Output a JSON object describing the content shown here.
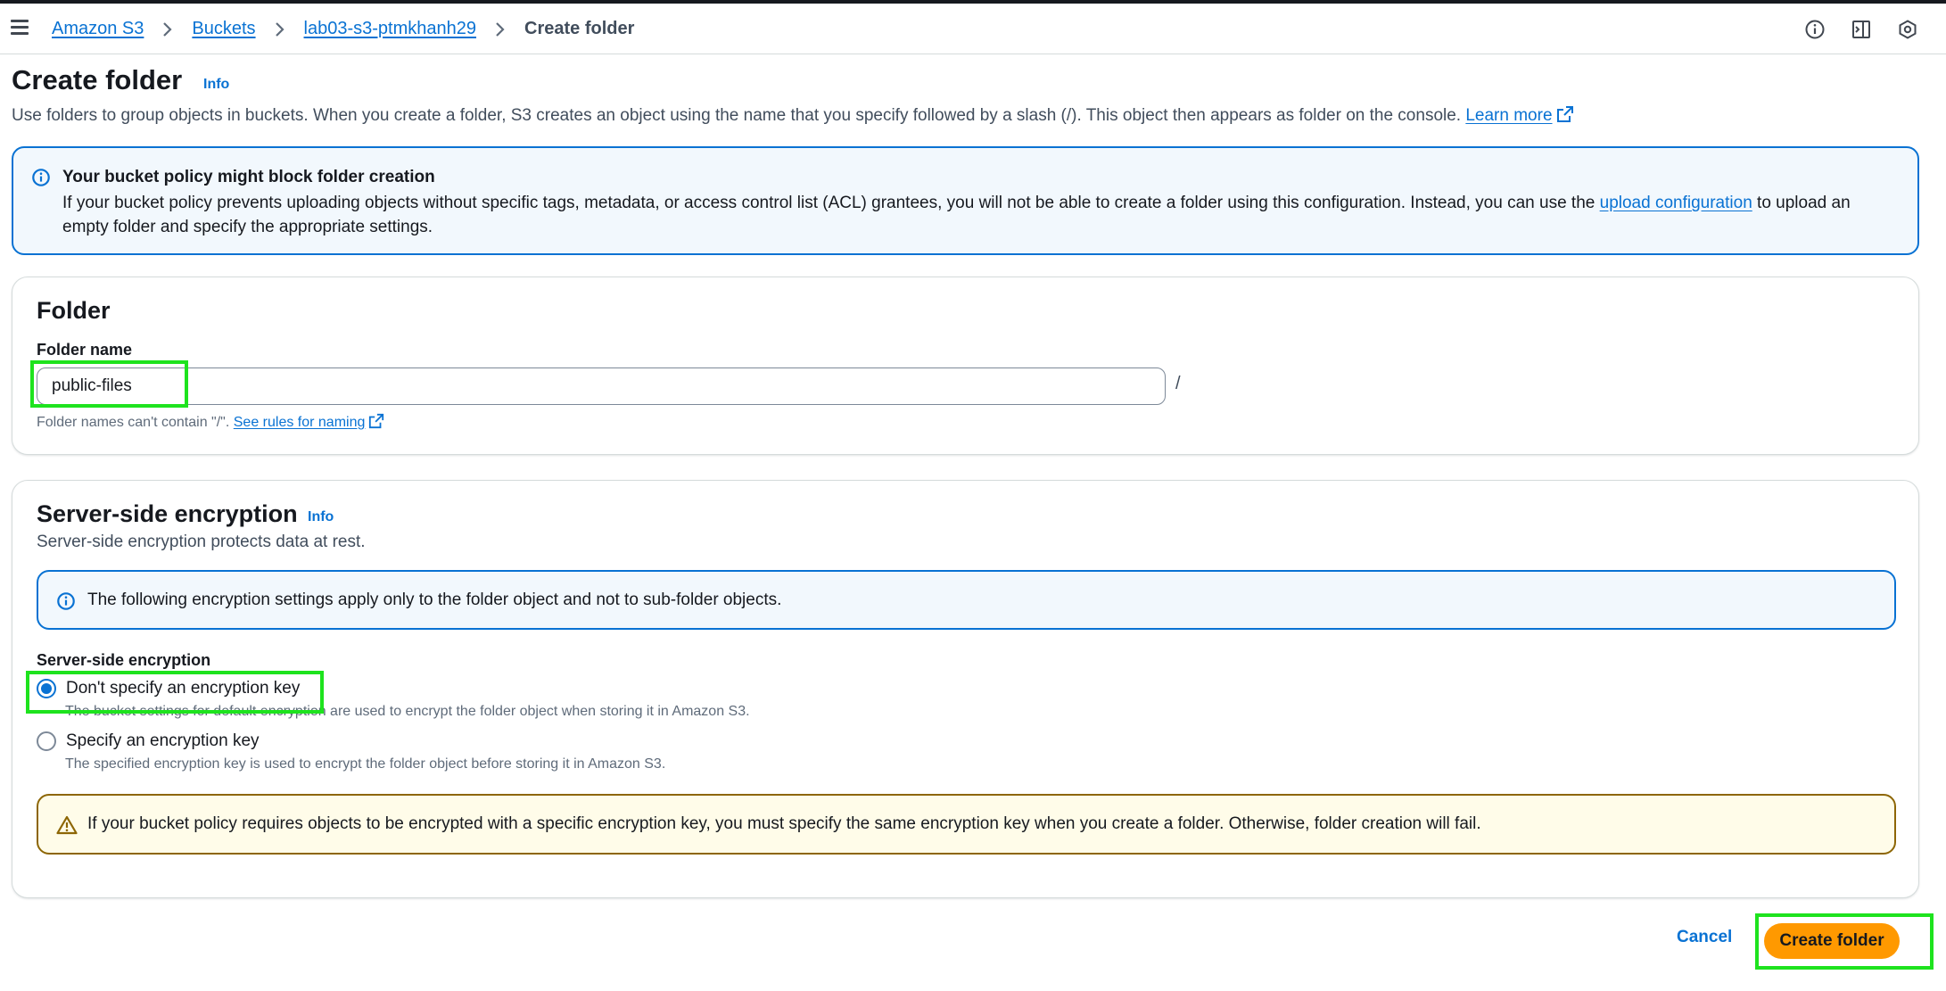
{
  "breadcrumb": {
    "items": [
      "Amazon S3",
      "Buckets",
      "lab03-s3-ptmkhanh29"
    ],
    "current": "Create folder"
  },
  "header": {
    "title": "Create folder",
    "info": "Info",
    "description": "Use folders to group objects in buckets. When you create a folder, S3 creates an object using the name that you specify followed by a slash (/). This object then appears as folder on the console.",
    "learn_more": "Learn more"
  },
  "policy_alert": {
    "title": "Your bucket policy might block folder creation",
    "body_before": "If your bucket policy prevents uploading objects without specific tags, metadata, or access control list (ACL) grantees, you will not be able to create a folder using this configuration. Instead, you can use the",
    "link": "upload configuration",
    "body_after": "to upload an empty folder and specify the appropriate settings."
  },
  "folder": {
    "title": "Folder",
    "name_label": "Folder name",
    "name_value": "public-files",
    "slash": "/",
    "hint": "Folder names can't contain \"/\".",
    "hint_link": "See rules for naming"
  },
  "encryption": {
    "title": "Server-side encryption",
    "info": "Info",
    "description": "Server-side encryption protects data at rest.",
    "alert": "The following encryption settings apply only to the folder object and not to sub-folder objects.",
    "field_label": "Server-side encryption",
    "options": [
      {
        "label": "Don't specify an encryption key",
        "description": "The bucket settings for default encryption are used to encrypt the folder object when storing it in Amazon S3.",
        "selected": true
      },
      {
        "label": "Specify an encryption key",
        "description": "The specified encryption key is used to encrypt the folder object before storing it in Amazon S3.",
        "selected": false
      }
    ],
    "warning": "If your bucket policy requires objects to be encrypted with a specific encryption key, you must specify the same encryption key when you create a folder. Otherwise, folder creation will fail."
  },
  "footer": {
    "cancel": "Cancel",
    "submit": "Create folder"
  },
  "colors": {
    "link": "#0972d3",
    "primary_button": "#ff9900",
    "highlight": "#1ee31e",
    "warning_border": "#8d6605"
  },
  "icons": [
    "menu-icon",
    "chevron-right-icon",
    "info-circle-icon",
    "side-panel-icon",
    "settings-hex-icon",
    "external-link-icon",
    "warning-triangle-icon"
  ]
}
